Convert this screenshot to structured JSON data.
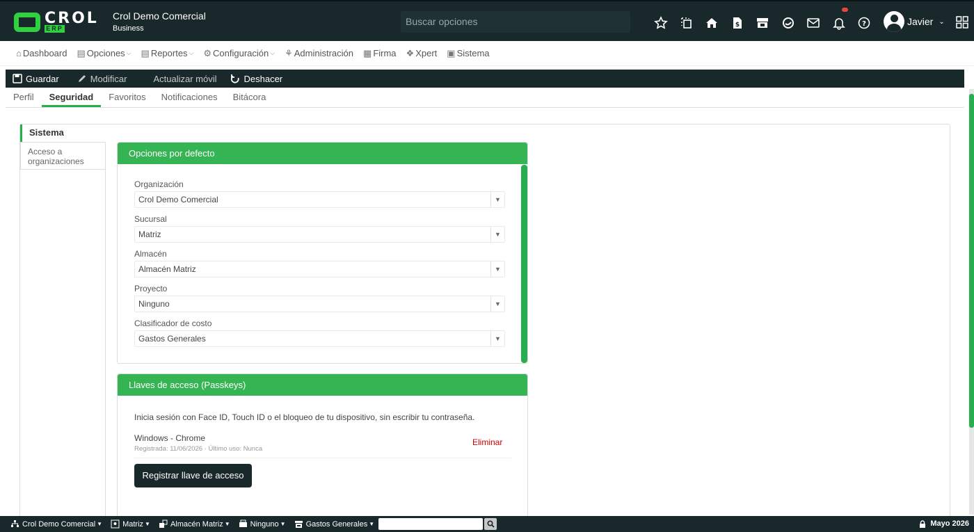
{
  "header": {
    "logo_text": "CROL",
    "logo_sub": "ERP",
    "company_name": "Crol Demo Comercial",
    "company_plan": "Business",
    "search_placeholder": "Buscar opciones",
    "icons": [
      "star-icon",
      "copy-icon",
      "home-icon",
      "invoice-icon",
      "store-icon",
      "chat-icon",
      "mail-icon",
      "bell-icon",
      "help-icon"
    ],
    "user_name": "Javier"
  },
  "menu": {
    "dashboard": "Dashboard",
    "opciones": "Opciones",
    "reportes": "Reportes",
    "configuracion": "Configuración",
    "administracion": "Administración",
    "firma": "Firma",
    "xpert": "Xpert",
    "sistema": "Sistema"
  },
  "actions": {
    "guardar": "Guardar",
    "modificar": "Modificar",
    "actualizar": "Actualizar móvil",
    "deshacer": "Deshacer"
  },
  "tabs": [
    "Perfil",
    "Seguridad",
    "Favoritos",
    "Notificaciones",
    "Bitácora"
  ],
  "active_tab": "Seguridad",
  "sidenav": {
    "sistema": "Sistema",
    "acceso": "Acceso a organizaciones"
  },
  "defaults_card": {
    "title": "Opciones por defecto",
    "fields": [
      {
        "label": "Organización",
        "value": "Crol Demo Comercial"
      },
      {
        "label": "Sucursal",
        "value": "Matriz"
      },
      {
        "label": "Almacén",
        "value": "Almacén Matriz"
      },
      {
        "label": "Proyecto",
        "value": "Ninguno"
      },
      {
        "label": "Clasificador de costo",
        "value": "Gastos Generales"
      }
    ]
  },
  "passkeys_card": {
    "title": "Llaves de acceso (Passkeys)",
    "description": "Inicia sesión con Face ID, Touch ID o el bloqueo de tu dispositivo, sin escribir tu contraseña.",
    "device": "Windows - Chrome",
    "meta": "Registrada: 11/06/2026 · Último uso: Nunca",
    "delete_label": "Eliminar",
    "register_label": "Registrar llave de acceso"
  },
  "footer": {
    "organization": "Crol Demo Comercial",
    "branch": "Matriz",
    "warehouse": "Almacén Matriz",
    "project": "Ninguno",
    "cost": "Gastos Generales",
    "date": "Mayo 2026"
  },
  "colors": {
    "accent": "#35b454",
    "dark": "#19282a",
    "danger": "#cc0000"
  }
}
